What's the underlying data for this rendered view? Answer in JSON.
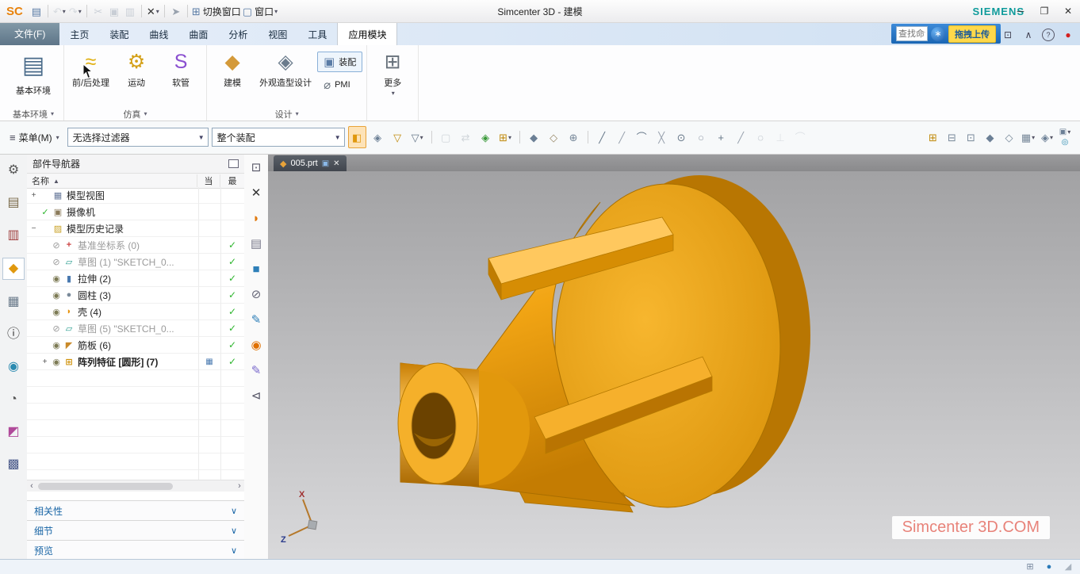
{
  "colors": {
    "accent_blue": "#1a72c2",
    "part_orange": "#f0a514",
    "check_green": "#2db52d",
    "siemens_teal": "#0f9b9b",
    "upload_yellow": "#ffd84a",
    "record_red": "#d42020"
  },
  "glyphs": {
    "dropdown": "▾",
    "select_arrow": "▼",
    "menu": "≡",
    "chevron": "∨",
    "sort": "▲",
    "cur_badge": "▦",
    "scroll_left": "‹",
    "scroll_right": "›",
    "part_tab": "◆",
    "float_tab": "▣",
    "close_tab": "✕",
    "cloud": "∗",
    "group_arrow": "▾"
  },
  "title_bar": {
    "logo": "SC",
    "title": "Simcenter 3D - 建模",
    "brand": "SIEMENS",
    "quick_access": [
      {
        "name": "save-icon",
        "glyph": "▤",
        "color": "#5a7ca6"
      },
      {
        "sep": true
      },
      {
        "name": "undo-icon",
        "glyph": "↶",
        "color": "#aab4be",
        "dropdown": true,
        "disabled": true
      },
      {
        "name": "redo-icon",
        "glyph": "↷",
        "color": "#aab4be",
        "dropdown": true,
        "disabled": true
      },
      {
        "sep": true
      },
      {
        "name": "cut-icon",
        "glyph": "✂",
        "color": "#8a97a8",
        "disabled": true
      },
      {
        "name": "copy-icon",
        "glyph": "▣",
        "color": "#8a97a8",
        "disabled": true
      },
      {
        "name": "paste-icon",
        "glyph": "▥",
        "color": "#8a97a8",
        "disabled": true
      },
      {
        "sep": true
      },
      {
        "name": "delete-icon",
        "glyph": "✕",
        "color": "#333333",
        "dropdown": true
      },
      {
        "sep": true
      },
      {
        "name": "repeat-command-icon",
        "glyph": "➤",
        "color": "#99a2ae"
      },
      {
        "sep": true
      },
      {
        "name": "switch-window-button",
        "glyph": "⊞",
        "color": "#5a7ca6",
        "label": "切换窗口"
      },
      {
        "name": "window-menu-button",
        "glyph": "▢",
        "color": "#5a7ca6",
        "label": "窗口",
        "dropdown": true
      }
    ],
    "window_controls": [
      {
        "name": "minimize-button",
        "glyph": "─"
      },
      {
        "name": "restore-button",
        "glyph": "❐"
      },
      {
        "name": "close-button",
        "glyph": "✕"
      }
    ]
  },
  "ribbon": {
    "file_tab": "文件(F)",
    "tabs": [
      "主页",
      "装配",
      "曲线",
      "曲面",
      "分析",
      "视图",
      "工具",
      "应用模块"
    ],
    "active_tab": "应用模块",
    "search_placeholder": "查找命令",
    "upload_label": "拖拽上传",
    "controls": [
      {
        "name": "fullscreen-button",
        "glyph": "⊡"
      },
      {
        "name": "minimize-ribbon-button",
        "glyph": "∧"
      },
      {
        "name": "help-button",
        "glyph": "?",
        "circle": true
      },
      {
        "name": "record-movie-button",
        "glyph": "●",
        "color": "#d42020"
      }
    ],
    "groups": [
      {
        "label": "基本环境",
        "buttons": [
          {
            "name": "base-environment-button",
            "label": "基本环境",
            "glyph": "▤",
            "color": "#4a6b8a",
            "big": true
          }
        ]
      },
      {
        "label": "仿真",
        "buttons": [
          {
            "name": "pre-post-button",
            "label": "前/后处理",
            "glyph": "≈",
            "color": "#e0b012"
          },
          {
            "name": "motion-button",
            "label": "运动",
            "glyph": "⚙",
            "color": "#d4a017"
          },
          {
            "name": "flexible-hose-button",
            "label": "软管",
            "glyph": "S",
            "color": "#8a4fd0"
          }
        ]
      },
      {
        "label": "设计",
        "buttons": [
          {
            "name": "modeling-button",
            "label": "建模",
            "glyph": "◆",
            "color": "#d49a3a"
          },
          {
            "name": "studio-design-button",
            "label": "外观造型设计",
            "glyph": "◈",
            "color": "#6a7b8c"
          },
          {
            "name": "assemblies-button",
            "label": "装配",
            "glyph": "▣",
            "color": "#5a7ca6",
            "stacked": true,
            "active": true
          },
          {
            "name": "pmi-button",
            "label": "PMI",
            "glyph": "⌀",
            "color": "#66707a",
            "stacked": true
          }
        ]
      },
      {
        "label": "",
        "buttons": [
          {
            "name": "more-button",
            "label": "更多",
            "glyph": "⊞",
            "color": "#66707a",
            "dropdown": true
          }
        ]
      }
    ]
  },
  "selection_bar": {
    "menu_label": "菜单(M)",
    "filter_value": "无选择过滤器",
    "scope_value": "整个装配",
    "icons": [
      {
        "name": "snap-point-toggle-icon",
        "glyph": "◧",
        "color": "#e0980e",
        "active": true
      },
      {
        "name": "select-body-icon",
        "glyph": "◈",
        "color": "#6b7f95"
      },
      {
        "name": "general-filter-icon",
        "glyph": "▽",
        "color": "#c0890a"
      },
      {
        "name": "filter-menu-icon",
        "glyph": "▽",
        "color": "#667788",
        "dropdown": true
      },
      {
        "sep": true
      },
      {
        "name": "deselect-all-icon",
        "glyph": "▢",
        "color": "#9aa4ae",
        "disabled": true
      },
      {
        "name": "reselect-icon",
        "glyph": "⇄",
        "color": "#9aa4ae",
        "disabled": true
      },
      {
        "name": "highlight-selection-icon",
        "glyph": "◈",
        "color": "#3a9a3a"
      },
      {
        "name": "add-to-selection-icon",
        "glyph": "⊞",
        "color": "#c0890a",
        "dropdown": true
      },
      {
        "sep": true
      },
      {
        "name": "solid-preselect-icon",
        "glyph": "◆",
        "color": "#6b7f95"
      },
      {
        "name": "facet-body-icon",
        "glyph": "◇",
        "color": "#9a8a6a"
      },
      {
        "name": "wcs-toggle-icon",
        "glyph": "⊕",
        "color": "#778899"
      },
      {
        "sep": true
      },
      {
        "name": "snap-endpoint-icon",
        "glyph": "╱",
        "color": "#667788"
      },
      {
        "name": "snap-midpoint-icon",
        "glyph": "╱",
        "color": "#99a2ae"
      },
      {
        "name": "snap-control-point-icon",
        "glyph": "⌒",
        "color": "#667788"
      },
      {
        "name": "snap-intersection-icon",
        "glyph": "╳",
        "color": "#99a2ae"
      },
      {
        "name": "snap-arc-center-icon",
        "glyph": "⊙",
        "color": "#667788"
      },
      {
        "name": "snap-quadrant-icon",
        "glyph": "○",
        "color": "#99a2ae"
      },
      {
        "name": "snap-existing-point-icon",
        "glyph": "+",
        "color": "#667788"
      },
      {
        "name": "snap-point-on-curve-icon",
        "glyph": "╱",
        "color": "#99a2ae"
      },
      {
        "name": "snap-point-on-face-icon",
        "glyph": "◌",
        "color": "#99a2ae"
      },
      {
        "name": "snap-bounded-grid-icon",
        "glyph": "⊥",
        "color": "#bbc2ca",
        "disabled": true
      },
      {
        "name": "snap-tangent-icon",
        "glyph": "⌒",
        "color": "#bbc2ca",
        "disabled": true
      }
    ],
    "right_icons": [
      {
        "name": "move-window-icon",
        "glyph": "⊞",
        "color": "#c0890a"
      },
      {
        "name": "float-window-icon",
        "glyph": "⊟",
        "color": "#778899"
      },
      {
        "name": "maximize-view-icon",
        "glyph": "⊡",
        "color": "#778899"
      },
      {
        "name": "shaded-mode-icon",
        "glyph": "◆",
        "color": "#6b7f95"
      },
      {
        "name": "wireframe-mode-icon",
        "glyph": "◇",
        "color": "#778899"
      },
      {
        "name": "window-layout-icon",
        "glyph": "▦",
        "color": "#778899",
        "dropdown": true
      },
      {
        "name": "rendering-style-icon",
        "glyph": "◈",
        "color": "#6b7f95",
        "dropdown": true
      }
    ],
    "stack_icons": [
      {
        "name": "view-orient-icon",
        "glyph": "▣",
        "color": "#6b7f95",
        "dropdown": true
      },
      {
        "name": "visual-effects-icon",
        "glyph": "◎",
        "color": "#2a8ab0"
      }
    ]
  },
  "resource_bar": {
    "icons": [
      {
        "name": "settings-icon",
        "glyph": "⚙",
        "color": "#555555"
      },
      {
        "name": "assembly-navigator-icon",
        "glyph": "▤",
        "color": "#7a6a4a"
      },
      {
        "name": "constraint-navigator-icon",
        "glyph": "▥",
        "color": "#a04040"
      },
      {
        "name": "part-navigator-icon",
        "glyph": "◆",
        "color": "#e0980e",
        "active": true
      },
      {
        "name": "reuse-library-icon",
        "glyph": "▦",
        "color": "#6a7a8a"
      },
      {
        "name": "hd3d-tools-icon",
        "glyph": "ⓘ",
        "color": "#333333"
      },
      {
        "name": "web-browser-icon",
        "glyph": "◉",
        "color": "#2a8ab0"
      },
      {
        "name": "history-icon",
        "glyph": "◔",
        "color": "#555555"
      },
      {
        "name": "roles-icon",
        "glyph": "◩",
        "color": "#b04a9a"
      },
      {
        "name": "visualization-scenes-icon",
        "glyph": "▩",
        "color": "#4a5a8a"
      }
    ]
  },
  "view_toolbar": {
    "icons": [
      {
        "name": "orient-view-icon",
        "glyph": "⊡",
        "color": "#555566"
      },
      {
        "name": "close-window-icon",
        "glyph": "✕",
        "color": "#333333"
      },
      {
        "name": "studio-render-icon",
        "glyph": "◗",
        "color": "#e07a10"
      },
      {
        "name": "save-view-icon",
        "glyph": "▤",
        "color": "#777788"
      },
      {
        "name": "fit-view-icon",
        "glyph": "■",
        "color": "#2e7fb8"
      },
      {
        "name": "hide-icon",
        "glyph": "⊘",
        "color": "#666677"
      },
      {
        "name": "edit-object-display-icon",
        "glyph": "✎",
        "color": "#2e7fb8"
      },
      {
        "name": "show-icon",
        "glyph": "◉",
        "color": "#e07000"
      },
      {
        "name": "annotation-icon",
        "glyph": "✎",
        "color": "#7a6acc"
      },
      {
        "name": "previous-view-icon",
        "glyph": "⊲",
        "color": "#555566"
      }
    ]
  },
  "navigator": {
    "title": "部件导航器",
    "columns": [
      "名称",
      "当",
      "最"
    ],
    "sort_glyph": "▲",
    "rows": [
      {
        "indent": 0,
        "expander": "+",
        "icon": "model-views",
        "icon_glyph": "▦",
        "icon_color": "#6a7b9c",
        "label": "模型视图"
      },
      {
        "indent": 0,
        "expander": "",
        "vis": "check",
        "icon": "cameras",
        "icon_glyph": "▣",
        "icon_color": "#8a7a5a",
        "label": "摄像机"
      },
      {
        "indent": 0,
        "expander": "−",
        "icon": "history-folder",
        "icon_glyph": "▨",
        "icon_color": "#c9a227",
        "label": "模型历史记录"
      },
      {
        "indent": 1,
        "vis": "hidden",
        "icon": "datum-csys",
        "icon_glyph": "+",
        "icon_color": "#cc4444",
        "label": "基准坐标系 (0)",
        "dim": true,
        "check": true
      },
      {
        "indent": 1,
        "vis": "hidden",
        "icon": "sketch",
        "icon_glyph": "▱",
        "icon_color": "#2a9d8f",
        "label": "草图 (1) \"SKETCH_0...",
        "dim": true,
        "check": true
      },
      {
        "indent": 1,
        "vis": "shown",
        "icon": "extrude",
        "icon_glyph": "▮",
        "icon_color": "#4a7ab0",
        "label": "拉伸 (2)",
        "check": true
      },
      {
        "indent": 1,
        "vis": "shown",
        "icon": "cylinder",
        "icon_glyph": "●",
        "icon_color": "#7a8a9a",
        "label": "圆柱 (3)",
        "check": true
      },
      {
        "indent": 1,
        "vis": "shown",
        "icon": "shell",
        "icon_glyph": "◗",
        "icon_color": "#e8930c",
        "label": "壳 (4)",
        "check": true
      },
      {
        "indent": 1,
        "vis": "hidden",
        "icon": "sketch",
        "icon_glyph": "▱",
        "icon_color": "#2a9d8f",
        "label": "草图 (5) \"SKETCH_0...",
        "dim": true,
        "check": true
      },
      {
        "indent": 1,
        "vis": "shown",
        "icon": "rib",
        "icon_glyph": "◤",
        "icon_color": "#c98a2a",
        "label": "筋板 (6)",
        "check": true
      },
      {
        "indent": 1,
        "expander": "+",
        "vis": "shown",
        "icon": "pattern-feature",
        "icon_glyph": "⊞",
        "icon_color": "#d0920a",
        "label": "阵列特征 [圆形] (7)",
        "bold": true,
        "check": true,
        "cur": true
      }
    ],
    "sections": [
      {
        "name": "dependencies",
        "label": "相关性"
      },
      {
        "name": "details",
        "label": "细节"
      },
      {
        "name": "preview",
        "label": "预览"
      }
    ]
  },
  "viewport": {
    "tab_label": "005.prt",
    "watermark": "Simcenter 3D.COM",
    "triad": {
      "x_label": "X",
      "z_label": "Z"
    }
  },
  "status_bar": {
    "icons": [
      {
        "name": "grid-toggle-icon",
        "glyph": "⊞",
        "color": "#7a8aa0"
      },
      {
        "name": "connection-status-icon",
        "glyph": "●",
        "color": "#2a7ab8"
      },
      {
        "name": "resize-grip-icon",
        "glyph": "◢",
        "color": "#aab4c0"
      }
    ]
  }
}
